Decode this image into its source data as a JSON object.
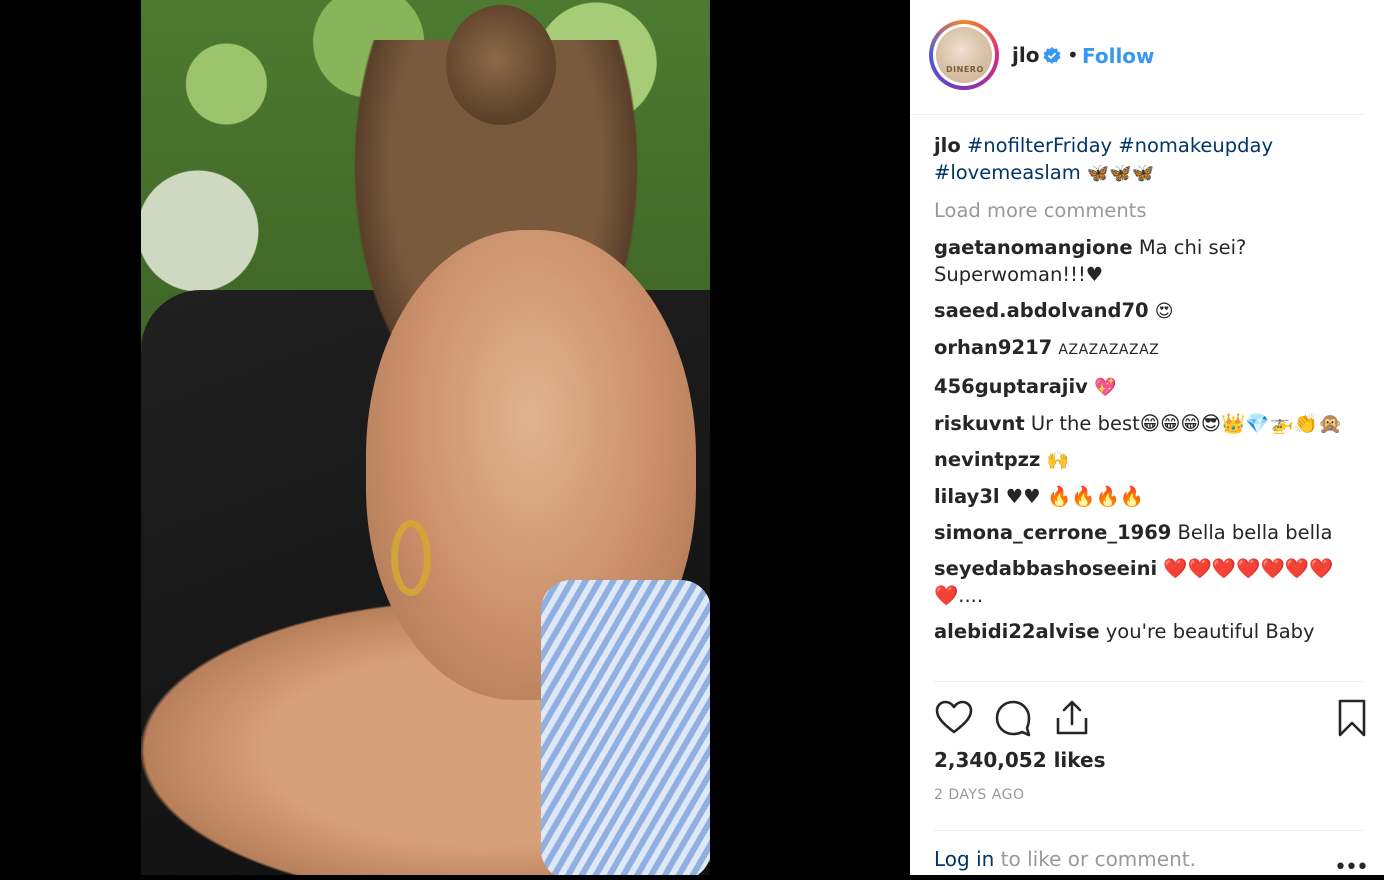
{
  "post": {
    "username": "jlo",
    "follow_label": "Follow",
    "separator": "•",
    "avatar_text": "DINERO"
  },
  "caption": {
    "user": "jlo",
    "tags": [
      "#nofilterFriday",
      "#nomakeupday",
      "#lovemeaslam"
    ],
    "emoji": "🦋🦋🦋"
  },
  "load_more_label": "Load more comments",
  "comments": [
    {
      "user": "gaetanomangione",
      "text": "Ma chi sei? Superwoman!!!♥"
    },
    {
      "user": "saeed.abdolvand70",
      "text": "😍"
    },
    {
      "user": "orhan9217",
      "text": "AZAZAZAZAZ"
    },
    {
      "user": "456guptarajiv",
      "text": "💖"
    },
    {
      "user": "riskuvnt",
      "text": "Ur the best😁😁😁😎👑💎🚁👏🙊"
    },
    {
      "user": "nevintpzz",
      "text": "🙌"
    },
    {
      "user": "lilay3l",
      "text": "♥♥ 🔥🔥🔥🔥"
    },
    {
      "user": "simona_cerrone_1969",
      "text": "Bella bella bella"
    },
    {
      "user": "seyedabbashoseeini",
      "text": "❤️❤️❤️❤️❤️❤️❤️❤️...."
    },
    {
      "user": "alebidi22alvise",
      "text": "you're beautiful Baby"
    }
  ],
  "likes": "2,340,052 likes",
  "timestamp": "2 DAYS AGO",
  "login": {
    "link_label": "Log in",
    "rest": " to like or comment."
  },
  "more_label": "•••",
  "colors": {
    "link_blue": "#3897f0",
    "hashtag": "#003569",
    "muted": "#999999"
  }
}
